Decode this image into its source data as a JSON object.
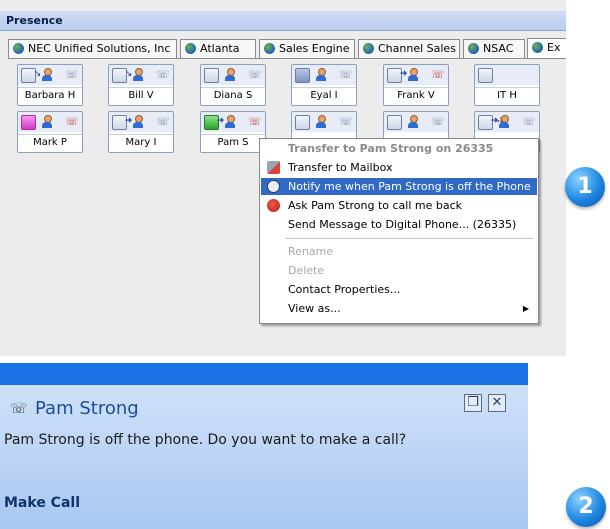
{
  "panel": {
    "title": "Presence"
  },
  "tabs": [
    {
      "label": "NEC Unified Solutions, Inc"
    },
    {
      "label": "Atlanta"
    },
    {
      "label": "Sales Engine"
    },
    {
      "label": "Channel Sales"
    },
    {
      "label": "NSAC"
    },
    {
      "label": "Ex"
    }
  ],
  "contacts": [
    {
      "name": "Barbara H"
    },
    {
      "name": "Bill V"
    },
    {
      "name": "Diana S"
    },
    {
      "name": "Eyal I"
    },
    {
      "name": "Frank V"
    },
    {
      "name": "IT H"
    },
    {
      "name": "Mark P"
    },
    {
      "name": "Mary I"
    },
    {
      "name": "Pam S"
    }
  ],
  "menu": {
    "header": "Transfer to Pam Strong on 26335",
    "items": [
      {
        "label": "Transfer to Mailbox",
        "icon": "transfer-icon"
      },
      {
        "label": "Notify me when Pam Strong is off the Phone",
        "icon": "clock-icon"
      },
      {
        "label": "Ask Pam Strong to call me back",
        "icon": "callback-icon"
      },
      {
        "label": "Send Message to Digital Phone... (26335)",
        "icon": ""
      },
      {
        "label": "Rename",
        "icon": ""
      },
      {
        "label": "Delete",
        "icon": ""
      },
      {
        "label": "Contact Properties...",
        "icon": ""
      },
      {
        "label": "View as...",
        "icon": ""
      }
    ]
  },
  "badges": {
    "one": "1",
    "two": "2"
  },
  "notification": {
    "title": "Pam Strong",
    "message": "Pam Strong is off the phone. Do you want to make a call?",
    "action": "Make Call"
  },
  "colors": {
    "highlight": "#316ac5",
    "toast_bar": "#1a72e6",
    "toast_title": "#1a4d9c"
  }
}
